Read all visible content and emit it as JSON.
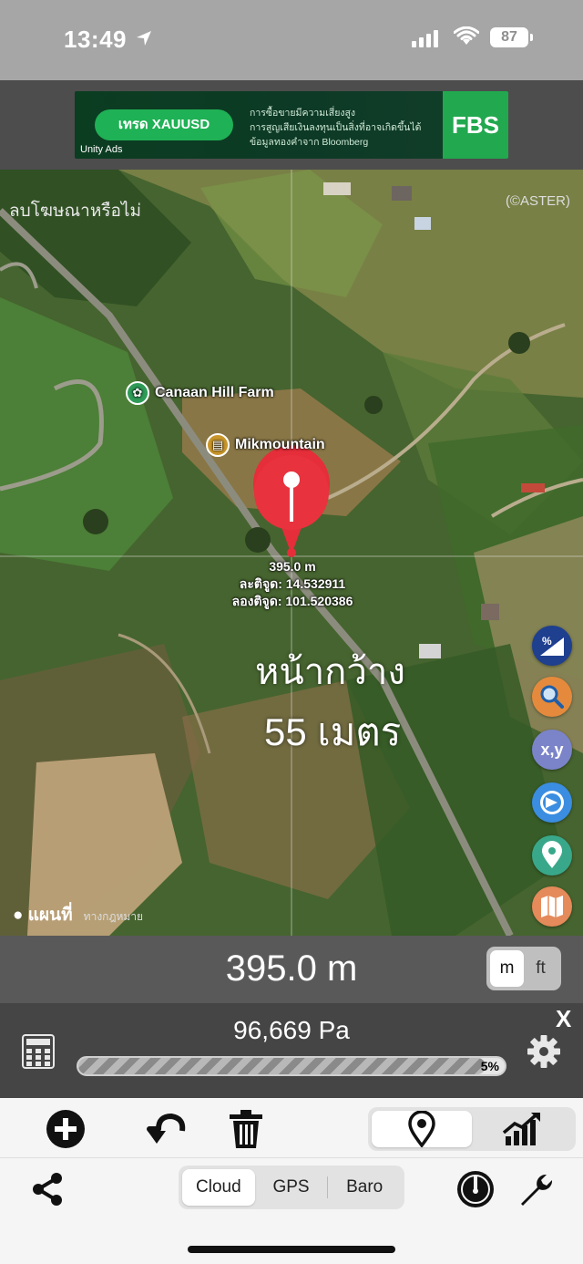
{
  "status_bar": {
    "time": "13:49",
    "battery": "87",
    "icons": [
      "location-arrow-icon",
      "signal-icon",
      "wifi-icon",
      "battery-icon"
    ]
  },
  "ad": {
    "button_label": "เทรด XAUUSD",
    "disclaimer_lines": [
      "การซื้อขายมีความเสี่ยงสูง",
      "การสูญเสียเงินลงทุนเป็นสิ่งที่อาจเกิดขึ้นได้",
      "ข้อมูลทองคำจาก Bloomberg"
    ],
    "brand": "FBS",
    "network": "Unity Ads"
  },
  "map": {
    "remove_ads_text": "ลบโฆษณาหรือไม่",
    "attribution": "(©ASTER)",
    "pois": [
      {
        "name": "Canaan Hill Farm",
        "icon": "sprout-icon",
        "color": "#2e9b57"
      },
      {
        "name": "Mikmountain",
        "icon": "basket-icon",
        "color": "#c9962a"
      }
    ],
    "pin": {
      "altitude": "395.0 m",
      "latitude_line": "ละติจูด: 14.532911",
      "longitude_line": "ลองติจูด: 101.520386",
      "color": "#e52e3a"
    },
    "overlay_title": "หน้ากว้าง",
    "overlay_subtitle": "55 เมตร",
    "brand": "แผนที่",
    "legal": "ทางกฎหมาย",
    "side_buttons": [
      {
        "name": "percent-grade-button",
        "label": "%",
        "color": "#1f3f8f"
      },
      {
        "name": "search-button",
        "label": "",
        "color": "#e58a3c"
      },
      {
        "name": "coordinates-button",
        "label": "x,y",
        "color": "#7b84c9"
      },
      {
        "name": "gps-track-button",
        "label": "",
        "color": "#3a8de0"
      },
      {
        "name": "map-pin-button",
        "label": "",
        "color": "#39a88a"
      },
      {
        "name": "map-layers-button",
        "label": "",
        "color": "#e58a5a"
      }
    ]
  },
  "altitude_bar": {
    "value": "395.0 m",
    "units": [
      "m",
      "ft"
    ],
    "selected_unit": "m"
  },
  "pressure_bar": {
    "value": "96,669 Pa",
    "progress_label": "5%",
    "progress_fraction": 0.955,
    "close_label": "X"
  },
  "toolbar": {
    "icons": [
      "add-icon",
      "undo-icon",
      "trash-icon"
    ],
    "view_modes": [
      "location-pin-icon",
      "chart-icon"
    ],
    "selected_view": "location-pin-icon"
  },
  "bottom_bar": {
    "sources": [
      "Cloud",
      "GPS",
      "Baro"
    ],
    "selected_source": "Cloud"
  }
}
